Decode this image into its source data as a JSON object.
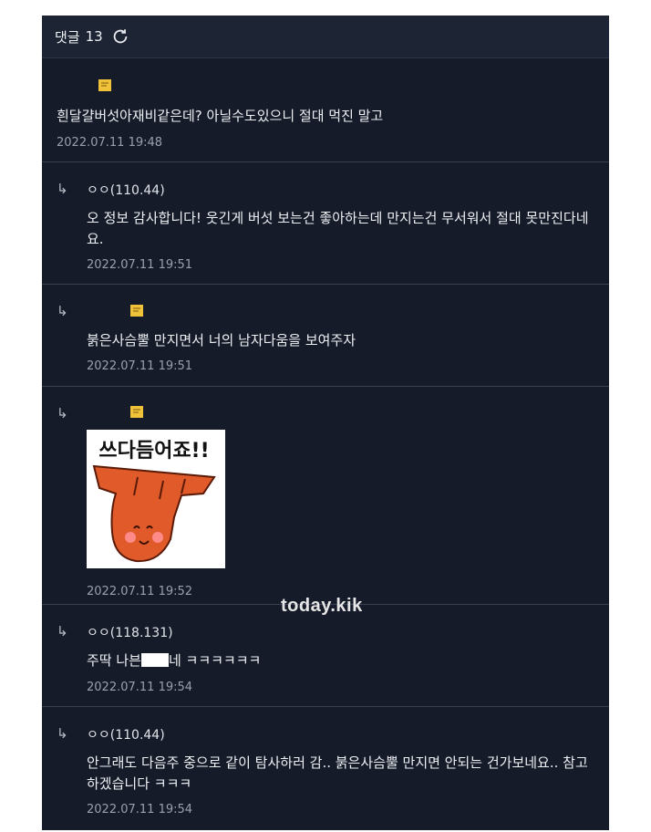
{
  "header": {
    "title": "댓글",
    "count": "13",
    "refresh_icon": "refresh-icon"
  },
  "comments": [
    {
      "author": "",
      "badge_icon": "note-icon",
      "text": "흰달걀버섯아재비같은데? 아닐수도있으니 절대 먹진 말고",
      "date": "2022.07.11 19:48"
    },
    {
      "reply_arrow": "↳",
      "author": "ㅇㅇ(110.44)",
      "text": "오 정보 감사합니다! 웃긴게 버섯 보는건 좋아하는데 만지는건 무서워서 절대 못만진다네요.",
      "date": "2022.07.11 19:51"
    },
    {
      "reply_arrow": "↳",
      "author": "",
      "badge_icon": "note-icon",
      "text": "붉은사슴뿔 만지면서 너의 남자다움을 보여주자",
      "date": "2022.07.11 19:51"
    },
    {
      "reply_arrow": "↳",
      "author": "",
      "badge_icon": "note-icon",
      "sticker_text": "쓰다듬어죠!!",
      "date": "2022.07.11 19:52"
    },
    {
      "reply_arrow": "↳",
      "author": "ㅇㅇ(118.131)",
      "text_before": "주딱 나븐",
      "text_after": "네 ㅋㅋㅋㅋㅋㅋ",
      "date": "2022.07.11 19:54"
    },
    {
      "reply_arrow": "↳",
      "author": "ㅇㅇ(110.44)",
      "text": "안그래도 다음주 중으로 같이 탐사하러 감.. 붉은사슴뿔 만지면 안되는 건가보네요.. 참고 하겠습니다 ㅋㅋㅋ",
      "date": "2022.07.11 19:54"
    }
  ],
  "watermark": "today.kik",
  "colors": {
    "panel": "#151b29",
    "header": "#1d2434",
    "divider": "#3a4152",
    "date": "#9aa0ad",
    "sticker_mushroom": "#e05a2a"
  }
}
